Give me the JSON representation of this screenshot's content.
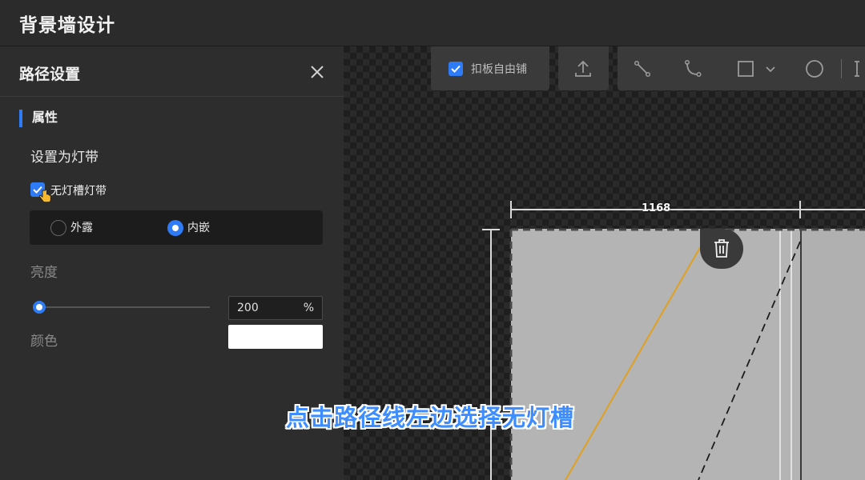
{
  "app": {
    "title": "背景墙设计"
  },
  "panel": {
    "title": "路径设置",
    "section_title": "属性",
    "set_as_label": "设置为灯带",
    "no_slot_checkbox": {
      "label": "无灯槽灯带",
      "checked": true
    },
    "mount_options": [
      {
        "label": "外露",
        "selected": false
      },
      {
        "label": "内嵌",
        "selected": true
      }
    ],
    "brightness": {
      "label": "亮度",
      "value": "200",
      "unit": "%",
      "level": 0.0
    },
    "color": {
      "label": "颜色",
      "value": "#ffffff"
    }
  },
  "toolbar": {
    "free_tile": {
      "label": "扣板自由铺",
      "checked": true
    },
    "tools": [
      "upload-icon",
      "line-tool-icon",
      "arc-tool-icon",
      "rectangle-tool-icon",
      "dropdown-chevron-icon",
      "circle-tool-icon"
    ]
  },
  "canvas": {
    "dimension_label": "1168"
  },
  "subtitle": "点击路径线左边选择无灯槽",
  "colors": {
    "accent": "#2f7bf5",
    "path_line": "#e0a020",
    "subtitle": "#3d8dff"
  }
}
